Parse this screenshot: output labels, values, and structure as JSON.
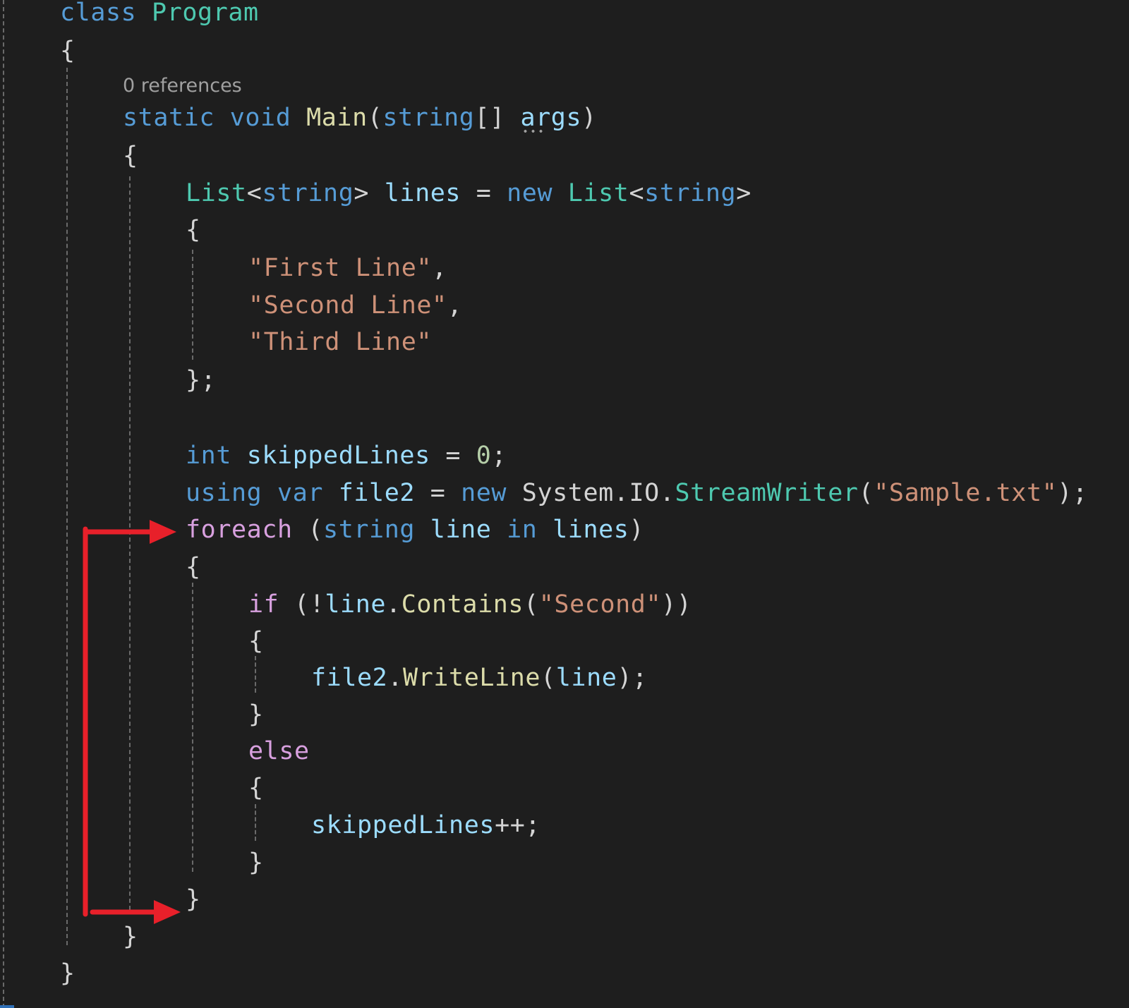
{
  "editor": {
    "codelens": "0 references",
    "lines": [
      [
        [
          "kw",
          "class"
        ],
        [
          "plain",
          " "
        ],
        [
          "type",
          "Program"
        ]
      ],
      [
        [
          "plain",
          "{"
        ]
      ],
      [
        [
          "kw",
          "static"
        ],
        [
          "plain",
          " "
        ],
        [
          "kw",
          "void"
        ],
        [
          "plain",
          " "
        ],
        [
          "meth",
          "Main"
        ],
        [
          "plain",
          "("
        ],
        [
          "kw",
          "string"
        ],
        [
          "plain",
          "[] "
        ],
        [
          "var",
          "args"
        ],
        [
          "plain",
          ")"
        ]
      ],
      [
        [
          "plain",
          "{"
        ]
      ],
      [
        [
          "type",
          "List"
        ],
        [
          "plain",
          "<"
        ],
        [
          "kw",
          "string"
        ],
        [
          "plain",
          "> "
        ],
        [
          "var",
          "lines"
        ],
        [
          "plain",
          " = "
        ],
        [
          "kw",
          "new"
        ],
        [
          "plain",
          " "
        ],
        [
          "type",
          "List"
        ],
        [
          "plain",
          "<"
        ],
        [
          "kw",
          "string"
        ],
        [
          "plain",
          ">"
        ]
      ],
      [
        [
          "plain",
          "{"
        ]
      ],
      [
        [
          "str",
          "\"First Line\""
        ],
        [
          "plain",
          ","
        ]
      ],
      [
        [
          "str",
          "\"Second Line\""
        ],
        [
          "plain",
          ","
        ]
      ],
      [
        [
          "str",
          "\"Third Line\""
        ]
      ],
      [
        [
          "plain",
          "};"
        ]
      ],
      [],
      [
        [
          "kw",
          "int"
        ],
        [
          "plain",
          " "
        ],
        [
          "var",
          "skippedLines"
        ],
        [
          "plain",
          " = "
        ],
        [
          "num",
          "0"
        ],
        [
          "plain",
          ";"
        ]
      ],
      [
        [
          "kw",
          "using"
        ],
        [
          "plain",
          " "
        ],
        [
          "kw",
          "var"
        ],
        [
          "plain",
          " "
        ],
        [
          "var",
          "file2"
        ],
        [
          "plain",
          " = "
        ],
        [
          "kw",
          "new"
        ],
        [
          "plain",
          " System.IO."
        ],
        [
          "type",
          "StreamWriter"
        ],
        [
          "plain",
          "("
        ],
        [
          "str",
          "\"Sample.txt\""
        ],
        [
          "plain",
          ");"
        ]
      ],
      [
        [
          "ctl",
          "foreach"
        ],
        [
          "plain",
          " ("
        ],
        [
          "kw",
          "string"
        ],
        [
          "plain",
          " "
        ],
        [
          "var",
          "line"
        ],
        [
          "plain",
          " "
        ],
        [
          "kw",
          "in"
        ],
        [
          "plain",
          " "
        ],
        [
          "var",
          "lines"
        ],
        [
          "plain",
          ")"
        ]
      ],
      [
        [
          "plain",
          "{"
        ]
      ],
      [
        [
          "ctl",
          "if"
        ],
        [
          "plain",
          " (!"
        ],
        [
          "var",
          "line"
        ],
        [
          "plain",
          "."
        ],
        [
          "meth",
          "Contains"
        ],
        [
          "plain",
          "("
        ],
        [
          "str",
          "\"Second\""
        ],
        [
          "plain",
          "))"
        ]
      ],
      [
        [
          "plain",
          "{"
        ]
      ],
      [
        [
          "var",
          "file2"
        ],
        [
          "plain",
          "."
        ],
        [
          "meth",
          "WriteLine"
        ],
        [
          "plain",
          "("
        ],
        [
          "var",
          "line"
        ],
        [
          "plain",
          ");"
        ]
      ],
      [
        [
          "plain",
          "}"
        ]
      ],
      [
        [
          "ctl",
          "else"
        ]
      ],
      [
        [
          "plain",
          "{"
        ]
      ],
      [
        [
          "var",
          "skippedLines"
        ],
        [
          "plain",
          "++;"
        ]
      ],
      [
        [
          "plain",
          "}"
        ]
      ],
      [
        [
          "plain",
          "}"
        ]
      ],
      [
        [
          "plain",
          "}"
        ]
      ],
      [
        [
          "plain",
          "}"
        ]
      ]
    ]
  },
  "colors": {
    "background": "#1e1e1e",
    "keyword": "#569cd6",
    "control_keyword": "#d8a0df",
    "type": "#4ec9b0",
    "method": "#dcdcaa",
    "variable": "#9cdcfe",
    "string": "#ce9178",
    "number": "#b5cea8",
    "punctuation": "#d4d4d4",
    "codelens": "#a0a0a0",
    "indent_guide": "#6a6a6a",
    "annotation_arrow": "#e8202a"
  }
}
